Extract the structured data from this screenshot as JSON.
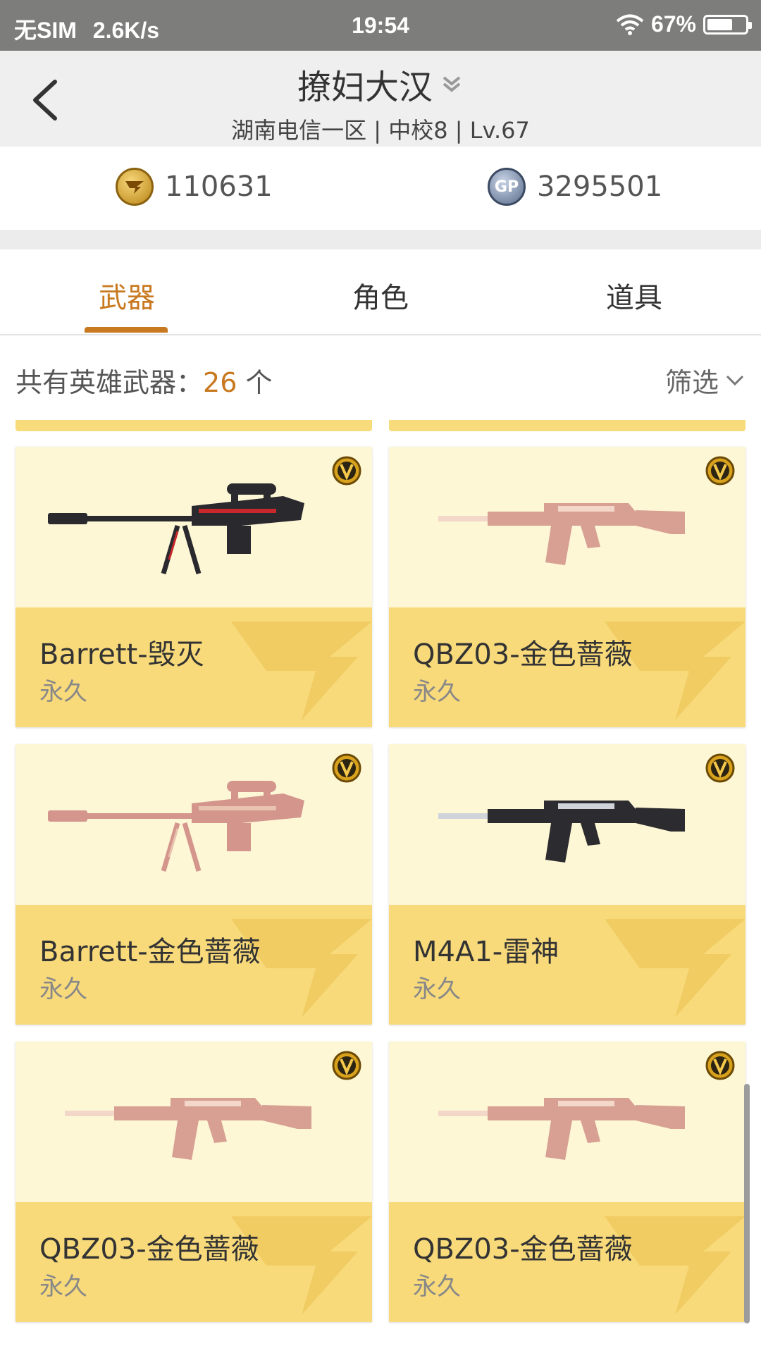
{
  "status_bar": {
    "carrier": "无SIM",
    "speed": "2.6K/s",
    "time": "19:54",
    "battery": "67%",
    "battery_level": 0.67
  },
  "header": {
    "title": "撩妇大汉",
    "subtitle": "湖南电信一区 | 中校8 | Lv.67"
  },
  "currency": {
    "cf_points": "110631",
    "gp": "3295501",
    "gp_label": "GP"
  },
  "tabs": [
    {
      "label": "武器",
      "active": true
    },
    {
      "label": "角色",
      "active": false
    },
    {
      "label": "道具",
      "active": false
    }
  ],
  "summary": {
    "prefix": "共有英雄武器：",
    "count": "26",
    "suffix": " 个",
    "filter_label": "筛选"
  },
  "weapons": [
    {
      "name": "Barrett-毁灭",
      "duration": "永久",
      "icon": "sniper-rifle-black-red"
    },
    {
      "name": "QBZ03-金色蔷薇",
      "duration": "永久",
      "icon": "assault-rifle-rose-gold"
    },
    {
      "name": "Barrett-金色蔷薇",
      "duration": "永久",
      "icon": "sniper-rifle-rose-gold"
    },
    {
      "name": "M4A1-雷神",
      "duration": "永久",
      "icon": "assault-rifle-silver-black"
    },
    {
      "name": "QBZ03-金色蔷薇",
      "duration": "永久",
      "icon": "assault-rifle-rose-gold"
    },
    {
      "name": "QBZ03-金色蔷薇",
      "duration": "永久",
      "icon": "assault-rifle-rose-gold"
    }
  ],
  "colors": {
    "accent": "#c8781e",
    "card_top": "#fef7d6",
    "card_bottom": "#f8da7b"
  }
}
